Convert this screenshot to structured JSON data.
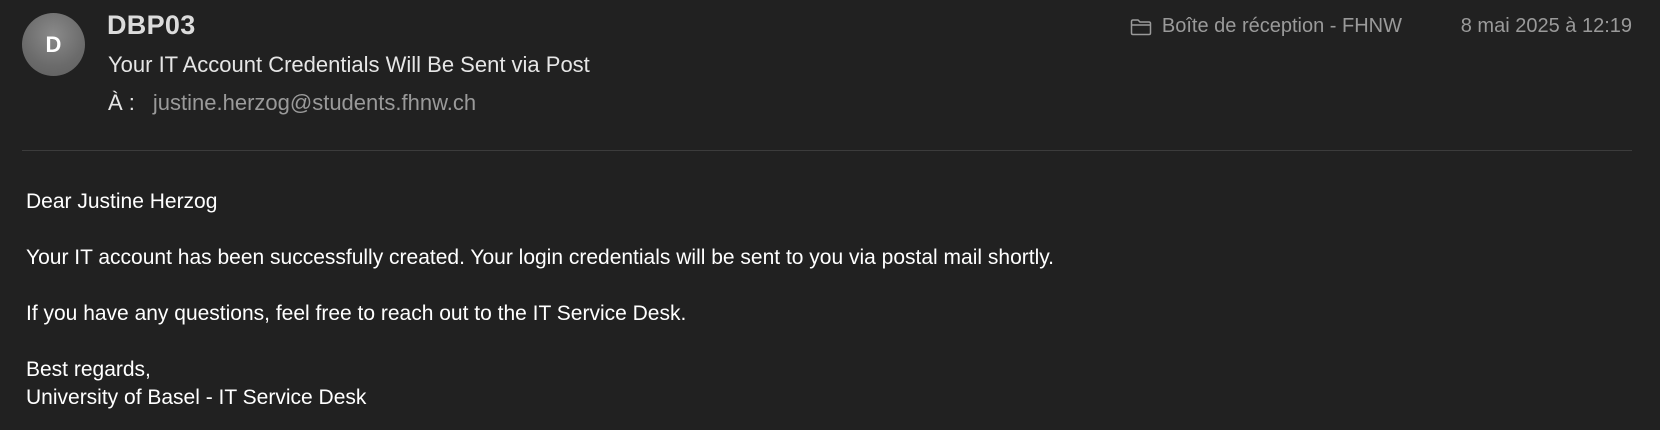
{
  "header": {
    "avatar_initial": "D",
    "sender": "DBP03",
    "subject": "Your IT Account Credentials Will Be Sent via Post",
    "to_label": "À :",
    "to_address": "justine.herzog@students.fhnw.ch",
    "mailbox": "Boîte de réception - FHNW",
    "mailbox_icon": "folder-icon",
    "date": "8 mai 2025 à 12:19"
  },
  "message": {
    "greeting": "Dear Justine Herzog",
    "paragraph1": "Your IT account has been successfully created. Your login credentials will be sent to you via postal mail shortly.",
    "paragraph2": "If you have any questions, feel free to reach out to the IT Service Desk.",
    "closing": "Best regards,",
    "signature": "University of Basel - IT Service Desk"
  },
  "colors": {
    "background": "#212121",
    "primary_text": "#e6e6e6",
    "secondary_text": "#9a9a9a",
    "avatar": "#6b6b6b"
  }
}
